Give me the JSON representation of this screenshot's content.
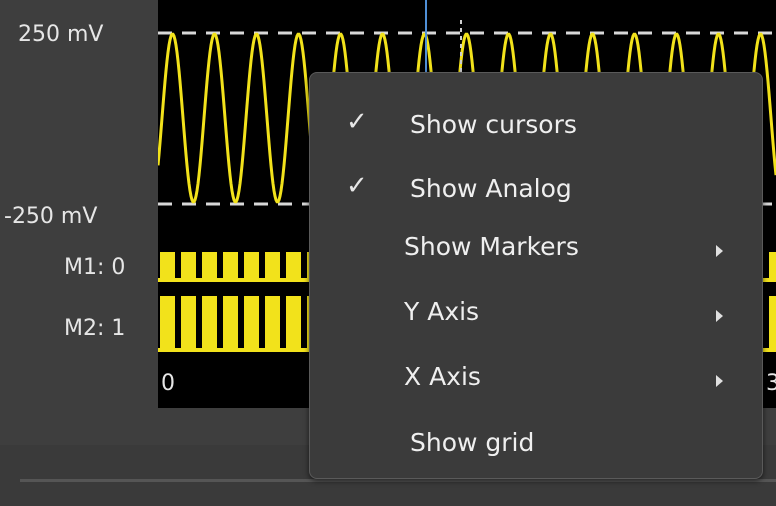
{
  "plot": {
    "y_max_label": "250 mV",
    "y_min_label": "-250 mV",
    "channels": [
      {
        "label": "M1: 0"
      },
      {
        "label": "M2: 1"
      }
    ],
    "x_axis_start_label": "0",
    "x_axis_right_label_partial": "3(",
    "colors": {
      "trace": "#f2e21b",
      "background": "#000000",
      "cursor": "#4f8fd6",
      "dashed_level": "#d8d8d8"
    }
  },
  "context_menu": {
    "items": [
      {
        "label": "Show cursors",
        "checked": true,
        "has_submenu": false
      },
      {
        "label": "Show Analog",
        "checked": true,
        "has_submenu": false
      },
      {
        "label": "Show Markers",
        "checked": false,
        "has_submenu": true
      },
      {
        "label": "Y Axis",
        "checked": false,
        "has_submenu": true
      },
      {
        "label": "X Axis",
        "checked": false,
        "has_submenu": true
      },
      {
        "label": "Show grid",
        "checked": false,
        "has_submenu": false
      }
    ],
    "check_glyph": "✓"
  }
}
